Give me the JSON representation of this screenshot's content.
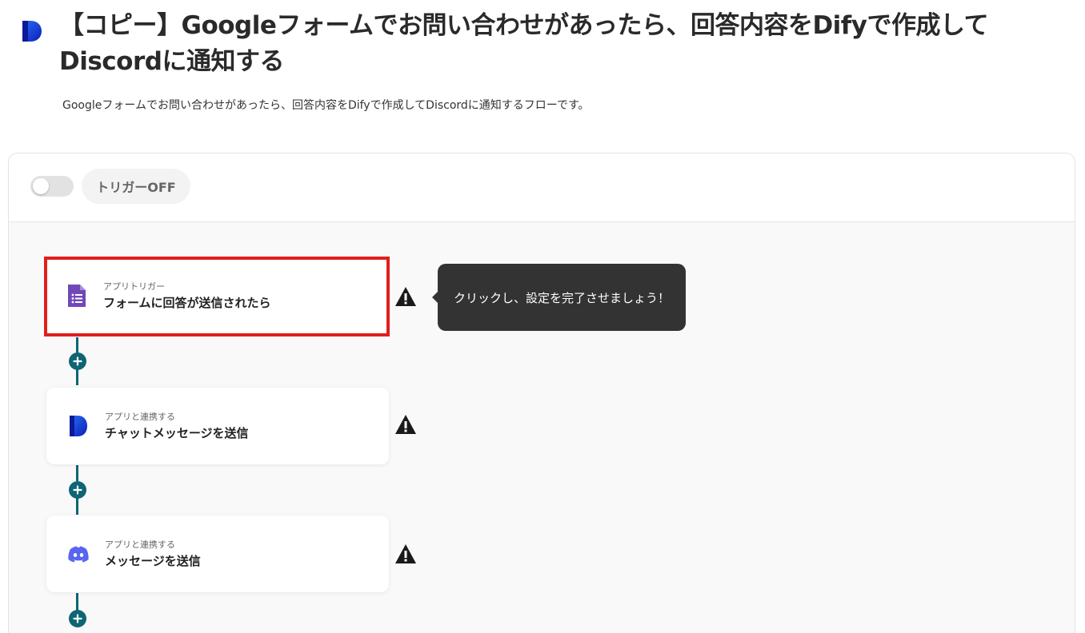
{
  "header": {
    "title": "【コピー】Googleフォームでお問い合わせがあったら、回答内容をDifyで作成してDiscordに通知する",
    "description": "Googleフォームでお問い合わせがあったら、回答内容をDifyで作成してDiscordに通知するフローです。",
    "logo_icon": "dify-logo-icon"
  },
  "trigger": {
    "toggle_state": "off",
    "label": "トリガーOFF"
  },
  "steps": [
    {
      "subtitle": "アプリトリガー",
      "title": "フォームに回答が送信されたら",
      "icon": "google-forms-icon",
      "highlighted": true,
      "warning": true
    },
    {
      "subtitle": "アプリと連携する",
      "title": "チャットメッセージを送信",
      "icon": "dify-icon",
      "highlighted": false,
      "warning": true
    },
    {
      "subtitle": "アプリと連携する",
      "title": "メッセージを送信",
      "icon": "discord-icon",
      "highlighted": false,
      "warning": true
    }
  ],
  "tooltip": {
    "text": "クリックし、設定を完了させましょう！"
  },
  "colors": {
    "accent": "#0e6573",
    "highlight_border": "#e01e1e",
    "tooltip_bg": "#333333",
    "google_forms": "#7248b9",
    "discord": "#5865f2",
    "dify_blue": "#1c3fd6"
  }
}
